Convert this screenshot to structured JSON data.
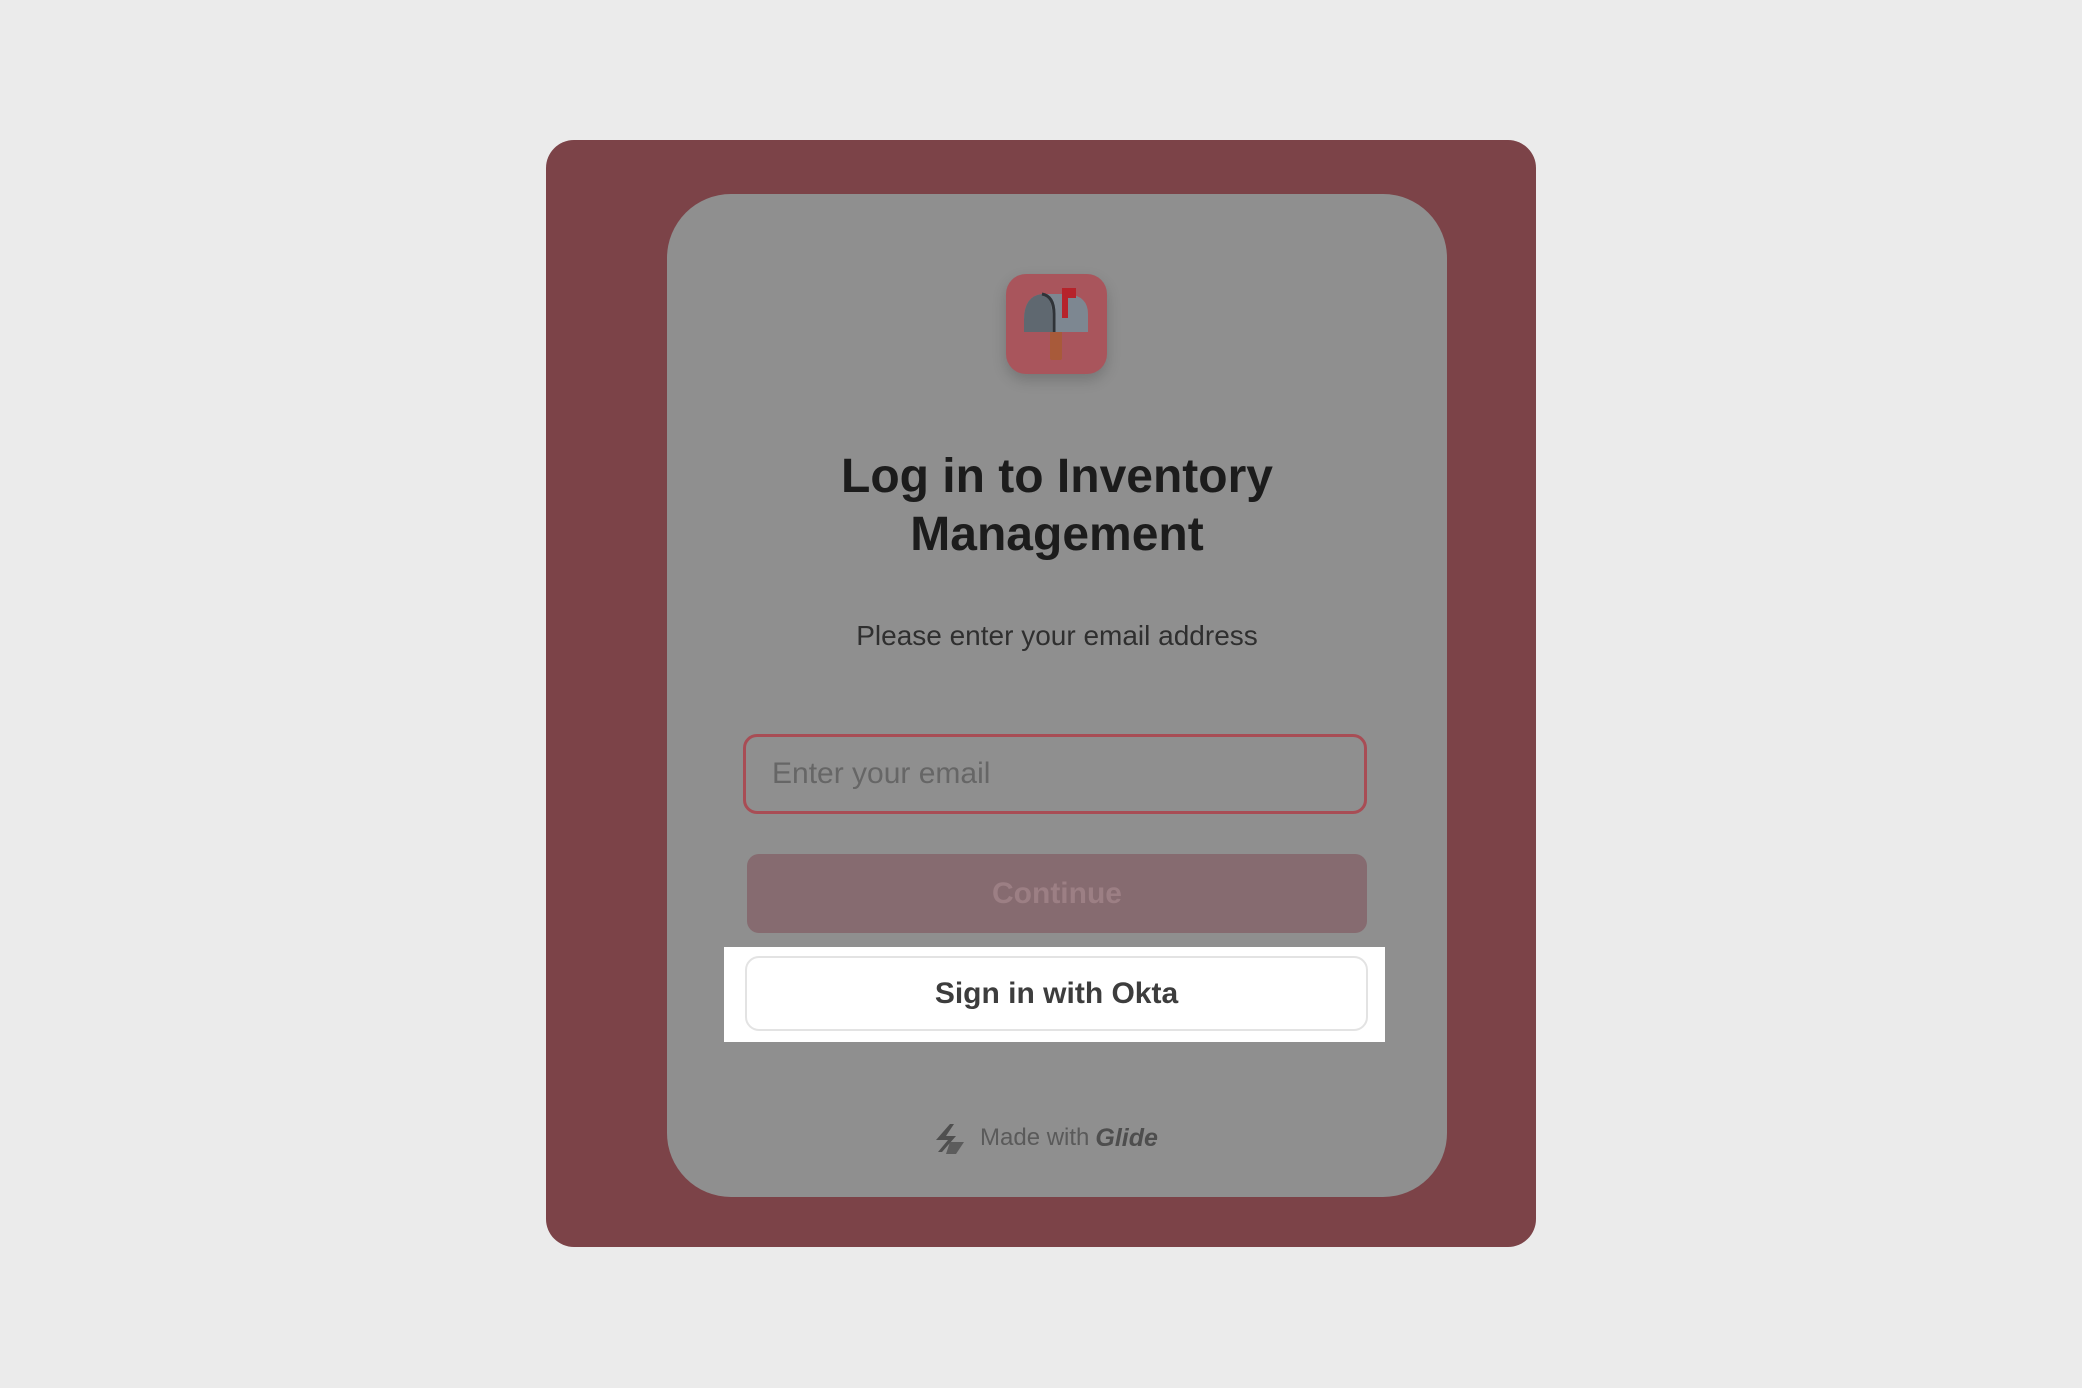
{
  "app": {
    "icon": "mailbox-icon",
    "icon_bg": "#a9555c"
  },
  "login": {
    "title": "Log in to Inventory Management",
    "subtitle": "Please enter your email address",
    "email_placeholder": "Enter your email",
    "email_value": "",
    "continue_label": "Continue",
    "okta_label": "Sign in with Okta"
  },
  "footer": {
    "made_with": "Made with",
    "brand": "Glide",
    "icon": "glide-logo-icon"
  },
  "colors": {
    "page_bg": "#ebebeb",
    "frame_bg": "#7c4348",
    "card_bg": "#8f8f8f",
    "accent": "#a84d55"
  }
}
